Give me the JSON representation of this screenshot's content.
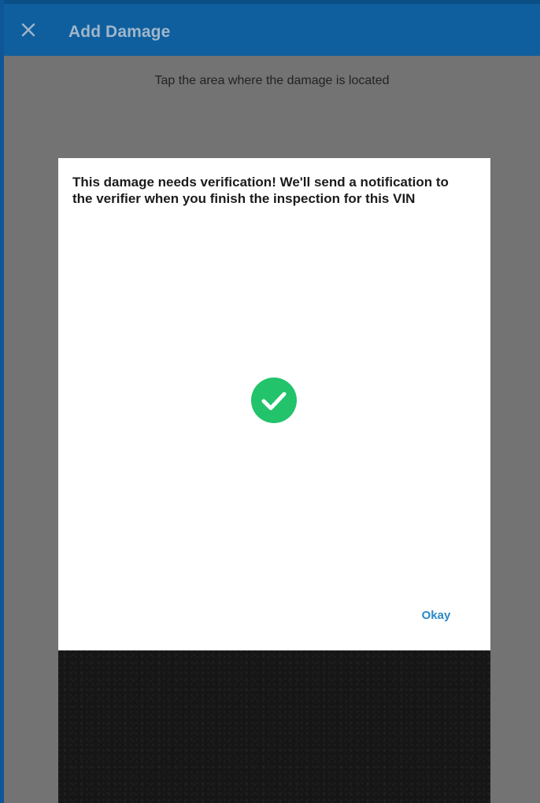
{
  "app_bar": {
    "title": "Add Damage",
    "close_icon": "close-icon",
    "background_color": "#0f5f9f",
    "title_color": "#9fb6ca"
  },
  "main": {
    "instruction": "Tap the area where the damage is located",
    "overlay_color": "#737373"
  },
  "dialog": {
    "message": "This damage needs verification! We'll send a notification to the verifier when you finish the inspection for this VIN",
    "status_icon": "check-circle-icon",
    "status_color": "#22c36b",
    "okay_label": "Okay",
    "button_color": "#2b88c8"
  }
}
